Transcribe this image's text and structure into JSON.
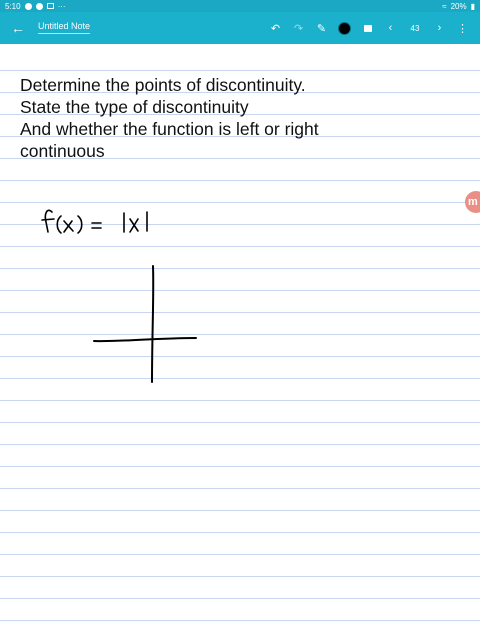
{
  "status_bar": {
    "time": "5:10",
    "battery": "20%",
    "more": "···"
  },
  "toolbar": {
    "title": "Untitled Note",
    "page_number": "43"
  },
  "note": {
    "prompt_lines": [
      "Determine the points of discontinuity.",
      "State the type of discontinuity",
      "And whether the function is left or right",
      "continuous"
    ],
    "handwritten_function": "f(x) = |x|"
  },
  "side_badge": {
    "label": "m"
  },
  "colors": {
    "toolbar": "#1bb0cc",
    "status_bar": "#1ba8c4",
    "rule_lines": "#c7d5ef",
    "ink": "#000000",
    "badge": "#e98f85"
  }
}
